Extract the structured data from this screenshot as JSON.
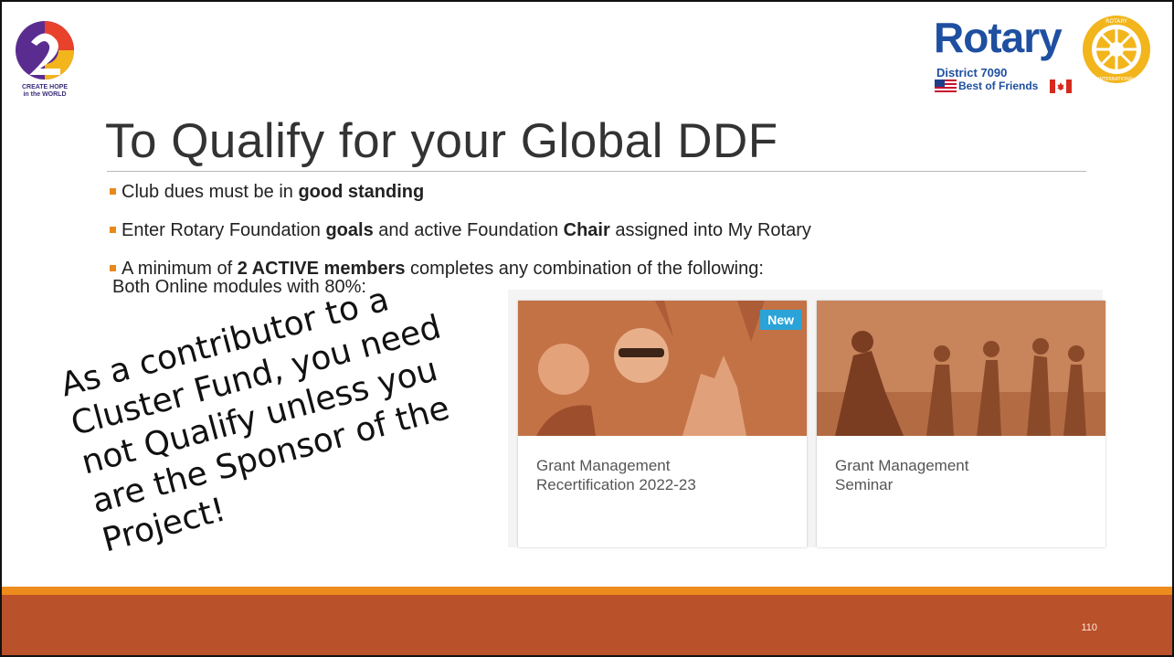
{
  "logos": {
    "left": {
      "tagline_line1": "CREATE HOPE",
      "tagline_line2": "in the WORLD"
    },
    "right": {
      "brand": "Rotary",
      "district": "District 7090",
      "motto": "Best of Friends",
      "wheel_text_top": "ROTARY",
      "wheel_text_bottom": "INTERNATIONAL"
    }
  },
  "title": "To Qualify for your Global DDF",
  "bullets": {
    "b1": {
      "pre": "Club dues must be in ",
      "bold": "good standing"
    },
    "b2": {
      "pre": "Enter Rotary Foundation ",
      "bold1": "goals",
      "mid": " and active Foundation ",
      "bold2": "Chair",
      "post": " assigned into My Rotary"
    },
    "b3": {
      "pre": "A minimum of ",
      "bold": "2 ACTIVE members",
      "post": " completes any combination of the following:",
      "sub": "Both Online modules with 80%:"
    }
  },
  "cards": [
    {
      "title_line1": "Grant Management",
      "title_line2": "Recertification 2022-23",
      "badge": "New"
    },
    {
      "title_line1": "Grant Management",
      "title_line2": "Seminar"
    }
  ],
  "note": {
    "lines": [
      "As a contributor to a",
      "Cluster Fund, you need",
      "not Qualify unless you",
      "are the Sponsor of the",
      "Project!"
    ]
  },
  "footer": {
    "page_number": "110"
  },
  "colors": {
    "accent_orange": "#ee8b1d",
    "footer_rust": "#b9512b",
    "rotary_blue": "#1f4fa0",
    "rotary_gold": "#f2b51c",
    "card_photo_tint": "#c87a4e",
    "badge_blue": "#2aa3d8"
  }
}
